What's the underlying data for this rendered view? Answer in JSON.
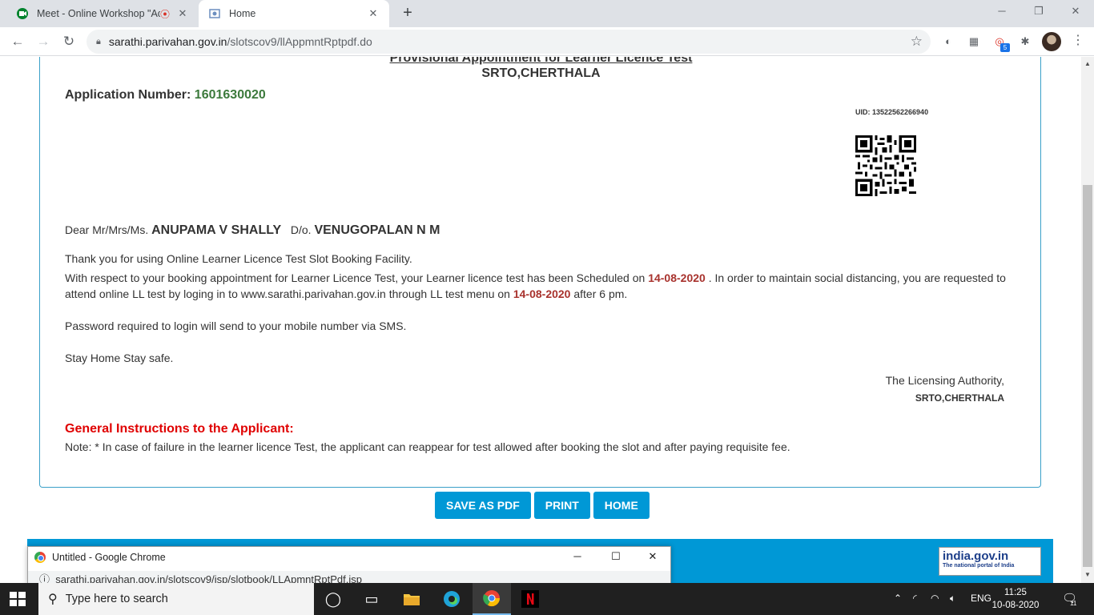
{
  "browser": {
    "tabs": [
      {
        "title": "Meet - Online Workshop \"Ac",
        "favicon": "google-meet-icon",
        "recording": true
      },
      {
        "title": "Home",
        "favicon": "parivahan-icon"
      }
    ],
    "address": {
      "host": "sarathi.parivahan.gov.in",
      "path": "/slotscov9/llAppmntRptpdf.do"
    },
    "extension_badge": "5"
  },
  "document": {
    "title": "Provisional Appointment for Learner Licence Test",
    "office": "SRTO,CHERTHALA",
    "application_label": "Application Number:",
    "application_number": "1601630020",
    "uid": "UID: 13522562266940",
    "salutation": "Dear Mr/Mrs/Ms.",
    "applicant_name": "ANUPAMA V SHALLY",
    "relation": "D/o.",
    "parent_name": "VENUGOPALAN N M",
    "thank_you": "Thank you for using Online Learner Licence Test Slot Booking Facility.",
    "para1_a": "With respect to your booking appointment for Learner Licence Test, your Learner licence test has been Scheduled on ",
    "test_date": "14-08-2020",
    "para1_b": " . In order to maintain social distancing, you are requested to",
    "para1_c": "attend online LL test by loging in to www.sarathi.parivahan.gov.in through LL test menu on ",
    "para1_d": " after 6 pm.",
    "password_note": "Password required to login will send to your mobile number via SMS.",
    "stay_safe": "Stay Home Stay safe.",
    "authority": "The Licensing Authority,",
    "authority_office": "SRTO,CHERTHALA",
    "instructions_title": "General Instructions to the Applicant:",
    "instructions_note": "Note: * In case of failure in the learner licence Test, the applicant can reappear for test allowed after booking the slot and after paying requisite fee."
  },
  "buttons": {
    "save_pdf": "SAVE AS PDF",
    "print": "PRINT",
    "home": "HOME"
  },
  "footer": {
    "portal_name": "india.gov.in",
    "portal_tagline": "The national portal of India"
  },
  "popup": {
    "title": "Untitled - Google Chrome",
    "url": "sarathi.parivahan.gov.in/slotscov9/jsp/slotbook/LLApmntRptPdf.jsp"
  },
  "taskbar": {
    "search_placeholder": "Type here to search",
    "language": "ENG",
    "time": "11:25",
    "date": "10-08-2020",
    "notifications": "11"
  },
  "colors": {
    "accent": "#0098d6",
    "date_highlight": "#a8322d",
    "instructions_red": "#e00000",
    "app_number_green": "#3c7a3c"
  }
}
